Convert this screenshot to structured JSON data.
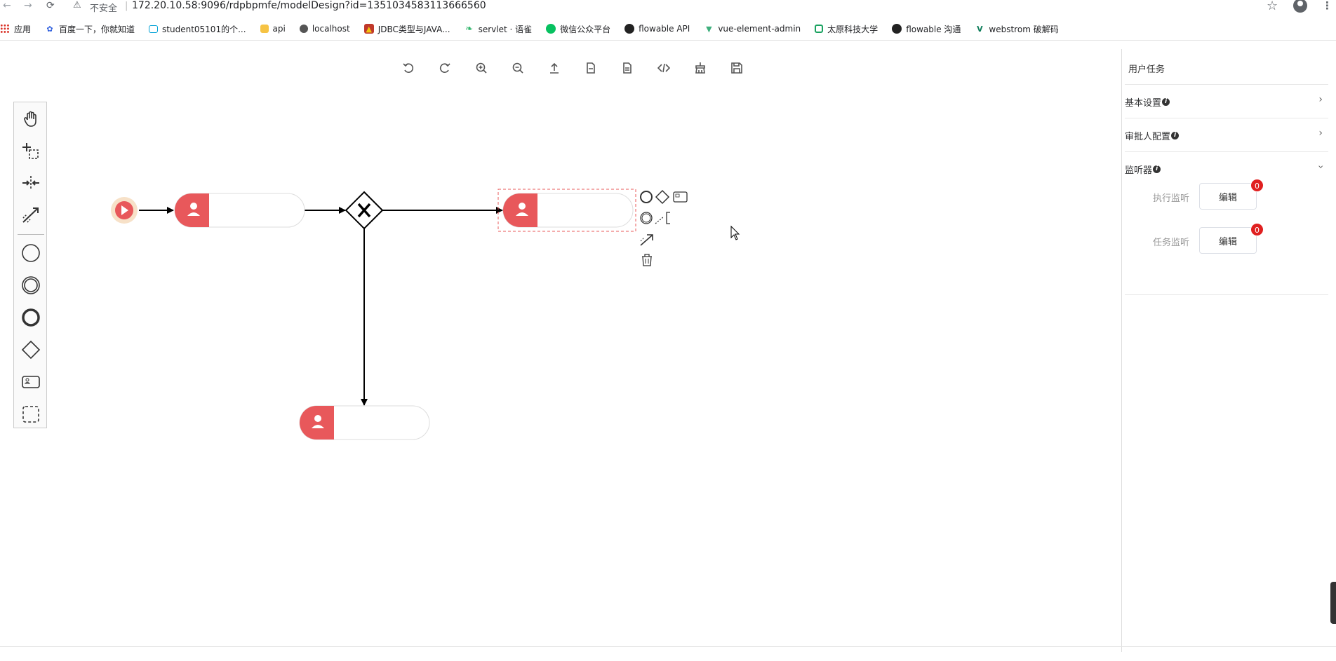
{
  "browser": {
    "back": "←",
    "forward": "→",
    "reload": "⟳",
    "security_label": "不安全",
    "url": "172.20.10.58:9096/rdpbpmfe/modelDesign?id=1351034583113666560",
    "bookmarks": [
      {
        "label": "应用",
        "icon": "apps-grid-icon"
      },
      {
        "label": "百度一下，你就知道",
        "icon": "baidu-icon",
        "color": "#2f5fde"
      },
      {
        "label": "student05101的个...",
        "icon": "bilibili-icon",
        "color": "#00a1d6"
      },
      {
        "label": "api",
        "icon": "folder-icon",
        "color": "#f6c344"
      },
      {
        "label": "localhost",
        "icon": "globe-icon",
        "color": "#555555"
      },
      {
        "label": "JDBC类型与JAVA...",
        "icon": "jdbc-icon",
        "color": "#c0392b"
      },
      {
        "label": "servlet · 语雀",
        "icon": "yuque-icon",
        "color": "#31b56b"
      },
      {
        "label": "微信公众平台",
        "icon": "wechat-icon",
        "color": "#07c160"
      },
      {
        "label": "flowable API",
        "icon": "github-icon",
        "color": "#222222"
      },
      {
        "label": "vue-element-admin",
        "icon": "vue-icon",
        "color": "#3eaf7c"
      },
      {
        "label": "太原科技大学",
        "icon": "school-icon",
        "color": "#1aa260"
      },
      {
        "label": "flowable 沟通",
        "icon": "github-icon",
        "color": "#222222"
      },
      {
        "label": "webstrom 破解码",
        "icon": "v-icon",
        "color": "#0c7c59"
      }
    ]
  },
  "toolbar": {
    "buttons": [
      {
        "name": "undo-button",
        "icon": "undo-icon"
      },
      {
        "name": "redo-button",
        "icon": "redo-icon"
      },
      {
        "name": "zoom-in-button",
        "icon": "zoom-in-icon"
      },
      {
        "name": "zoom-out-button",
        "icon": "zoom-out-icon"
      },
      {
        "name": "import-button",
        "icon": "upload-icon"
      },
      {
        "name": "export-bpmn-button",
        "icon": "file-bpmn-icon"
      },
      {
        "name": "export-svg-button",
        "icon": "file-svg-icon"
      },
      {
        "name": "view-xml-button",
        "icon": "code-icon"
      },
      {
        "name": "clear-button",
        "icon": "broom-icon"
      },
      {
        "name": "save-button",
        "icon": "save-icon"
      }
    ]
  },
  "palette": {
    "tools": [
      "hand-tool-icon",
      "lasso-tool-icon",
      "space-tool-icon",
      "global-connect-icon",
      "start-event-icon",
      "intermediate-event-icon",
      "end-event-icon",
      "gateway-icon",
      "user-task-icon",
      "subprocess-icon"
    ]
  },
  "diagram": {
    "accent_color": "#e8585b",
    "selection_color": "#e85a5a",
    "start_event_fill": "#f7e1c8"
  },
  "properties": {
    "title": "用户任务",
    "sections": [
      {
        "label": "基本设置",
        "expanded": false
      },
      {
        "label": "审批人配置",
        "expanded": false
      },
      {
        "label": "监听器",
        "expanded": true
      }
    ],
    "listeners": [
      {
        "label": "执行监听",
        "button": "编辑",
        "count": "0"
      },
      {
        "label": "任务监听",
        "button": "编辑",
        "count": "0"
      }
    ]
  }
}
